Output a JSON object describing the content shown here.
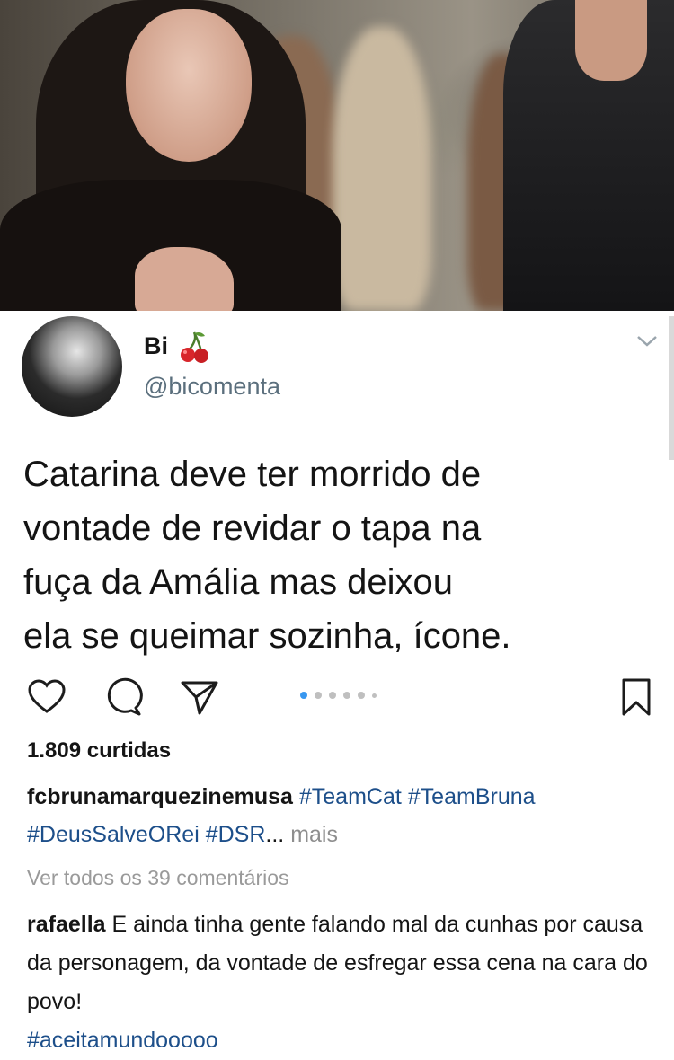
{
  "post": {
    "image_alt_icon": "tv-scene-photo",
    "author": {
      "name": "Bi",
      "emoji_icon": "cherry-icon",
      "handle": "@bicomenta"
    },
    "text": "Catarina deve ter morrido de\nvontade de revidar o tapa na\nfuça da Amália mas deixou\nela se queimar sozinha, ícone."
  },
  "actions": {
    "like_icon": "heart-icon",
    "comment_icon": "comment-icon",
    "share_icon": "send-icon",
    "save_icon": "bookmark-icon",
    "carousel": {
      "total": 6,
      "active_index": 0
    }
  },
  "likes": "1.809 curtidas",
  "caption": {
    "username": "fcbrunamarquezinemusa",
    "hashtags": [
      "#TeamCat",
      "#TeamBruna",
      "#DeusSalveORei",
      "#DSR"
    ],
    "ellipsis": "...",
    "more": "mais"
  },
  "view_all_comments": "Ver todos os 39 comentários",
  "comment": {
    "username": "rafaella",
    "text": "E ainda tinha gente falando mal da cunhas por causa da personagem, da vontade de esfregar essa cena na cara do povo!",
    "hashtag": "#aceitamundooooo"
  },
  "colors": {
    "hashtag": "#1d4f8a",
    "carousel_active": "#3897f0",
    "carousel_inactive": "#bfbfbf",
    "muted_text": "#9a9a9a"
  }
}
